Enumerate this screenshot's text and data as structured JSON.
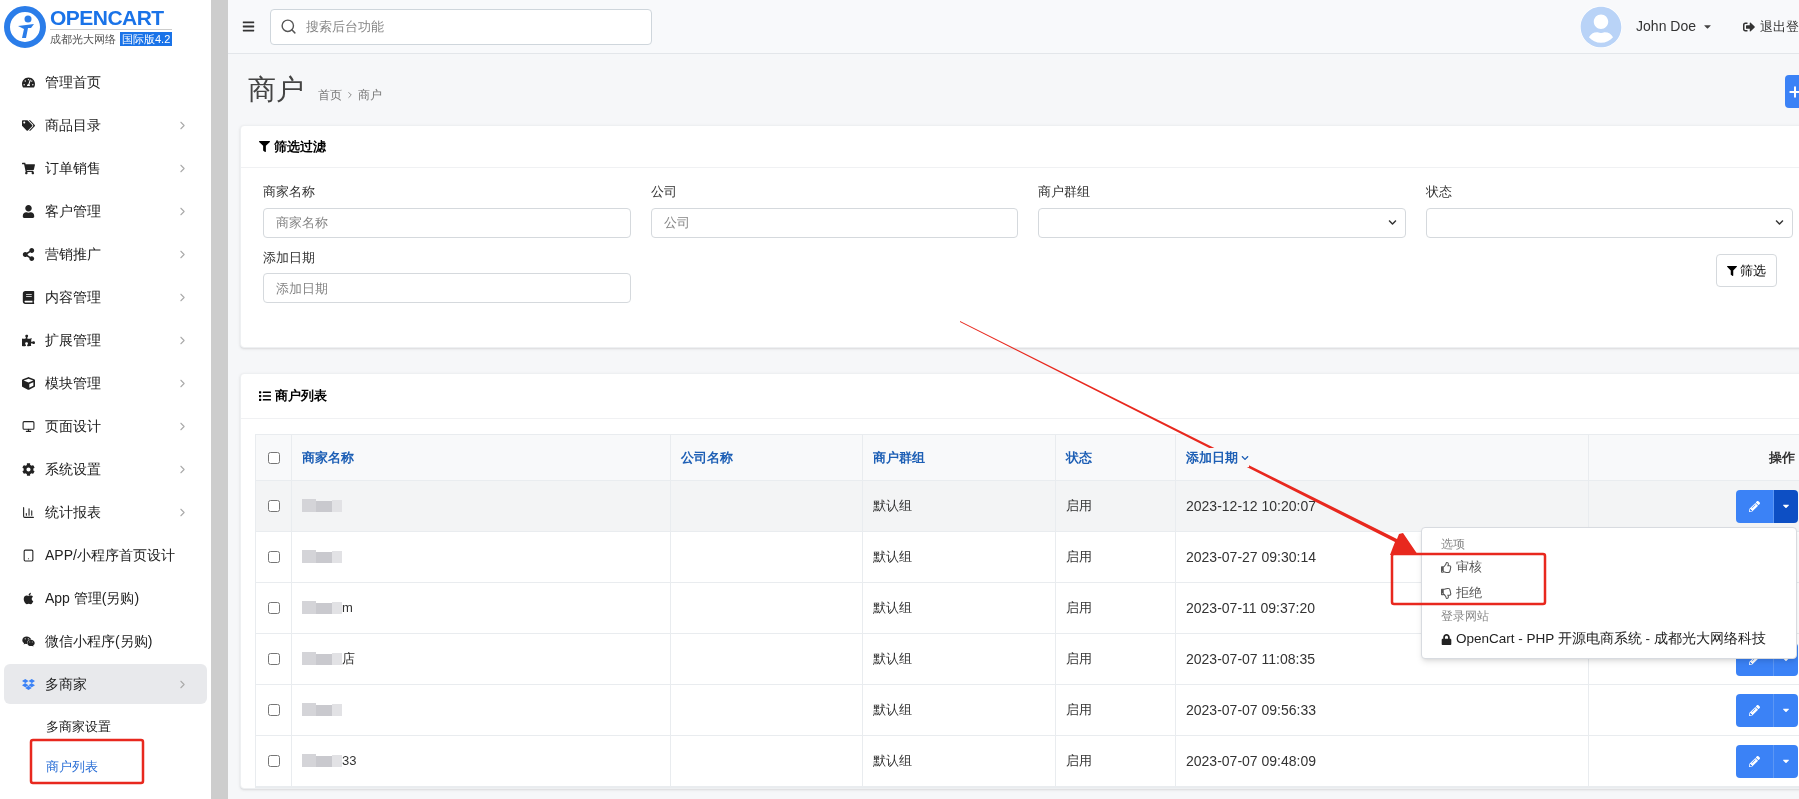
{
  "logo": {
    "brand": "OPENCART",
    "company": "成都光大网络",
    "edition": "国际版4.2"
  },
  "sidebar": {
    "items": [
      {
        "label": "管理首页",
        "expandable": false,
        "selected": false
      },
      {
        "label": "商品目录",
        "expandable": true,
        "selected": false
      },
      {
        "label": "订单销售",
        "expandable": true,
        "selected": false
      },
      {
        "label": "客户管理",
        "expandable": true,
        "selected": false
      },
      {
        "label": "营销推广",
        "expandable": true,
        "selected": false
      },
      {
        "label": "内容管理",
        "expandable": true,
        "selected": false
      },
      {
        "label": "扩展管理",
        "expandable": true,
        "selected": false
      },
      {
        "label": "模块管理",
        "expandable": true,
        "selected": false
      },
      {
        "label": "页面设计",
        "expandable": true,
        "selected": false
      },
      {
        "label": "系统设置",
        "expandable": true,
        "selected": false
      },
      {
        "label": "统计报表",
        "expandable": true,
        "selected": false
      },
      {
        "label": "APP/小程序首页设计",
        "expandable": false,
        "selected": false
      },
      {
        "label": "App 管理(另购)",
        "expandable": false,
        "selected": false
      },
      {
        "label": "微信小程序(另购)",
        "expandable": false,
        "selected": false
      },
      {
        "label": "多商家",
        "expandable": true,
        "selected": true,
        "children": [
          {
            "label": "多商家设置",
            "selected": false
          },
          {
            "label": "商户列表",
            "selected": true
          }
        ]
      }
    ]
  },
  "header": {
    "search_placeholder": "搜索后台功能",
    "user": "John Doe",
    "logout": "退出登"
  },
  "page": {
    "title": "商户",
    "breadcrumb": [
      "首页",
      "商户"
    ]
  },
  "filter": {
    "title": "筛选过滤",
    "fields": [
      {
        "kind": "text",
        "label": "商家名称",
        "placeholder": "商家名称"
      },
      {
        "kind": "text",
        "label": "公司",
        "placeholder": "公司"
      },
      {
        "kind": "select",
        "label": "商户群组"
      },
      {
        "kind": "select",
        "label": "状态"
      },
      {
        "kind": "text",
        "label": "添加日期",
        "placeholder": "添加日期"
      }
    ],
    "button": "筛选"
  },
  "list": {
    "title": "商户列表",
    "all_checked": false,
    "columns": [
      {
        "label": "商家名称",
        "sorted": false
      },
      {
        "label": "公司名称",
        "sorted": false
      },
      {
        "label": "商户群组",
        "sorted": false
      },
      {
        "label": "状态",
        "sorted": false
      },
      {
        "label": "添加日期",
        "sorted": true
      },
      {
        "label": "操作",
        "sorted": false
      }
    ],
    "rows": [
      {
        "checked": false,
        "hovered": true,
        "menu_open": true,
        "group": "默认组",
        "status": "启用",
        "date": "2023-12-12 10:20:07"
      },
      {
        "checked": false,
        "hovered": false,
        "menu_open": false,
        "group": "默认组",
        "status": "启用",
        "date": "2023-07-27 09:30:14"
      },
      {
        "checked": false,
        "hovered": false,
        "menu_open": false,
        "name_fragment": "m",
        "group": "默认组",
        "status": "启用",
        "date": "2023-07-11 09:37:20"
      },
      {
        "checked": false,
        "hovered": false,
        "menu_open": false,
        "name_fragment": "店",
        "group": "默认组",
        "status": "启用",
        "date": "2023-07-07 11:08:35"
      },
      {
        "checked": false,
        "hovered": false,
        "menu_open": false,
        "group": "默认组",
        "status": "启用",
        "date": "2023-07-07 09:56:33"
      },
      {
        "checked": false,
        "hovered": false,
        "menu_open": false,
        "name_fragment": "33",
        "group": "默认组",
        "status": "启用",
        "date": "2023-07-07 09:48:09"
      }
    ]
  },
  "dropdown": {
    "sections": [
      {
        "header": "选项",
        "items": [
          {
            "kind": "approve",
            "label": "审核"
          },
          {
            "kind": "reject",
            "label": "拒绝"
          }
        ]
      },
      {
        "header": "登录网站",
        "items": [
          {
            "kind": "store",
            "label": "OpenCart - PHP 开源电商系统 - 成都光大网络科技"
          }
        ]
      }
    ]
  }
}
